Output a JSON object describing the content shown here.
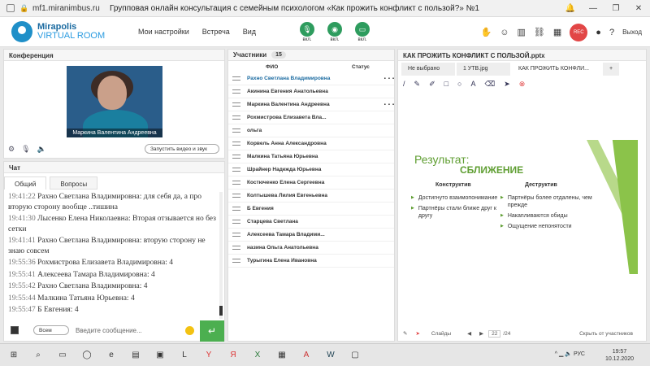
{
  "browser": {
    "url": "mf1.miranimbus.ru",
    "title": "Групповая онлайн консультация с семейным психологом «Как прожить конфликт с пользой?» №1"
  },
  "app": {
    "brand1": "Mirapolis",
    "brand2": "VIRTUAL ROOM",
    "menu": [
      "Мои настройки",
      "Встреча",
      "Вид"
    ],
    "ctrls": [
      {
        "label": "вкл."
      },
      {
        "label": "вкл."
      },
      {
        "label": "вкл."
      }
    ],
    "rec": "REC",
    "exit": "Выход"
  },
  "conference": {
    "title": "Конференция",
    "video_name": "Маркина Валентина Андреевна",
    "video_button": "Запустить видео и звук"
  },
  "chat": {
    "title": "Чат",
    "tabs": [
      "Общий",
      "Вопросы"
    ],
    "messages": [
      {
        "t": "19:41:22",
        "text": "Рахно Светлана Владимировна: для себя да, а про вторую сторону вообще ..тишина"
      },
      {
        "t": "19:41:30",
        "text": "Лысенко Елена Николаевна: Вторая отзывается но без сетки"
      },
      {
        "t": "19:41:41",
        "text": "Рахно Светлана Владимировна: вторую сторону не знаю совсем"
      },
      {
        "t": "19:55:36",
        "text": "Рохмистрова Елизавета Владимировна: 4"
      },
      {
        "t": "19:55:41",
        "text": "Алексеева Тамара Владимировна: 4"
      },
      {
        "t": "19:55:42",
        "text": "Рахно Светлана Владимировна: 4"
      },
      {
        "t": "19:55:44",
        "text": "Малкина Татьяна Юрьевна: 4"
      },
      {
        "t": "19:55:47",
        "text": "Б Евгения: 4"
      }
    ],
    "select": "Всем",
    "input_placeholder": "Введите сообщение..."
  },
  "participants": {
    "title": "Участники",
    "count": "15",
    "col_name": "ФИО",
    "col_status": "Статус",
    "rows": [
      "Рахно Светлана Владимировна",
      "Акинина Евгения Анатольевна",
      "Маркина Валентина Андреевна",
      "Рохмистрова Елизавета Вла...",
      "ольга",
      "Корвель Анна Александровна",
      "Малкина Татьяна Юрьевна",
      "Шрайнер Надежда Юрьевна",
      "Костюченко Елена Сергеевна",
      "Колтышева Лилия Евгеньевна",
      "Б Евгения",
      "Старцева Светлана",
      "Алексеева Тамара Владими...",
      "назина Ольга Анатольевна",
      "Турыгина Елена Ивановна"
    ]
  },
  "presentation": {
    "title": "КАК ПРОЖИТЬ КОНФЛИКТ С ПОЛЬЗОЙ.pptx",
    "tabs": [
      "Не выбрано",
      "1 УТВ.jpg",
      "КАК ПРОЖИТЬ КОНФЛИ...",
      "+"
    ],
    "slide": {
      "title": "Результат:",
      "subtitle": "СБЛИЖЕНИЕ",
      "col1_head": "Конструктив",
      "col1": [
        "Достигнуто взаимопонимание",
        "Партнёры стали ближе друг к другу"
      ],
      "col2_head": "Деструктив",
      "col2": [
        "Партнёры более отдалены, чем прежде",
        "Накапливаются обиды",
        "Ощущение непонятости"
      ]
    },
    "slides_label": "Слайды",
    "page": "22",
    "total": "/24",
    "hide": "Скрыть от участников"
  },
  "taskbar": {
    "lang": "РУС",
    "time": "19:57",
    "date": "10.12.2020"
  }
}
